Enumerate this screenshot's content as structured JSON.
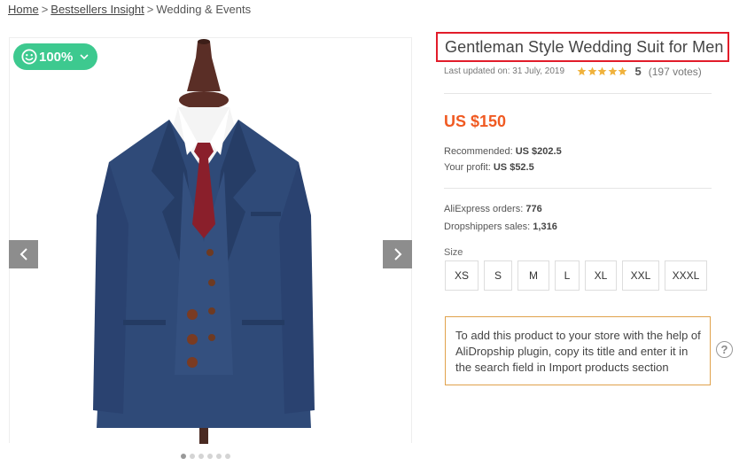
{
  "breadcrumb": {
    "home": "Home",
    "sep1": ">",
    "bestsellers": "Bestsellers Insight",
    "sep2": ">",
    "current": "Wedding & Events"
  },
  "badge": {
    "label": "100%",
    "color": "#3dc98f"
  },
  "product": {
    "title": "Gentleman Style Wedding Suit for Men",
    "last_updated": "Last updated on: 31 July, 2019",
    "rating_stars": 5,
    "rating": "5",
    "votes": "(197 votes)",
    "price": "US $150",
    "recommended_label": "Recommended:",
    "recommended_value": "US $202.5",
    "profit_label": "Your profit:",
    "profit_value": "US $52.5",
    "orders_label": "AliExpress orders:",
    "orders_value": "776",
    "sales_label": "Dropshippers sales:",
    "sales_value": "1,316",
    "size_label": "Size",
    "sizes": [
      "XS",
      "S",
      "M",
      "L",
      "XL",
      "XXL",
      "XXXL"
    ]
  },
  "gallery": {
    "slide_count": 6,
    "active_slide": 1
  },
  "help": {
    "text": "To add this product to your store with the help of AliDropship plugin, copy its title and enter it in the search field in Import products section",
    "icon": "?"
  },
  "colors": {
    "accent_price": "#f05a22",
    "highlight_border": "#e21c2a",
    "help_border": "#e0a24c",
    "star": "#f0b23c"
  }
}
